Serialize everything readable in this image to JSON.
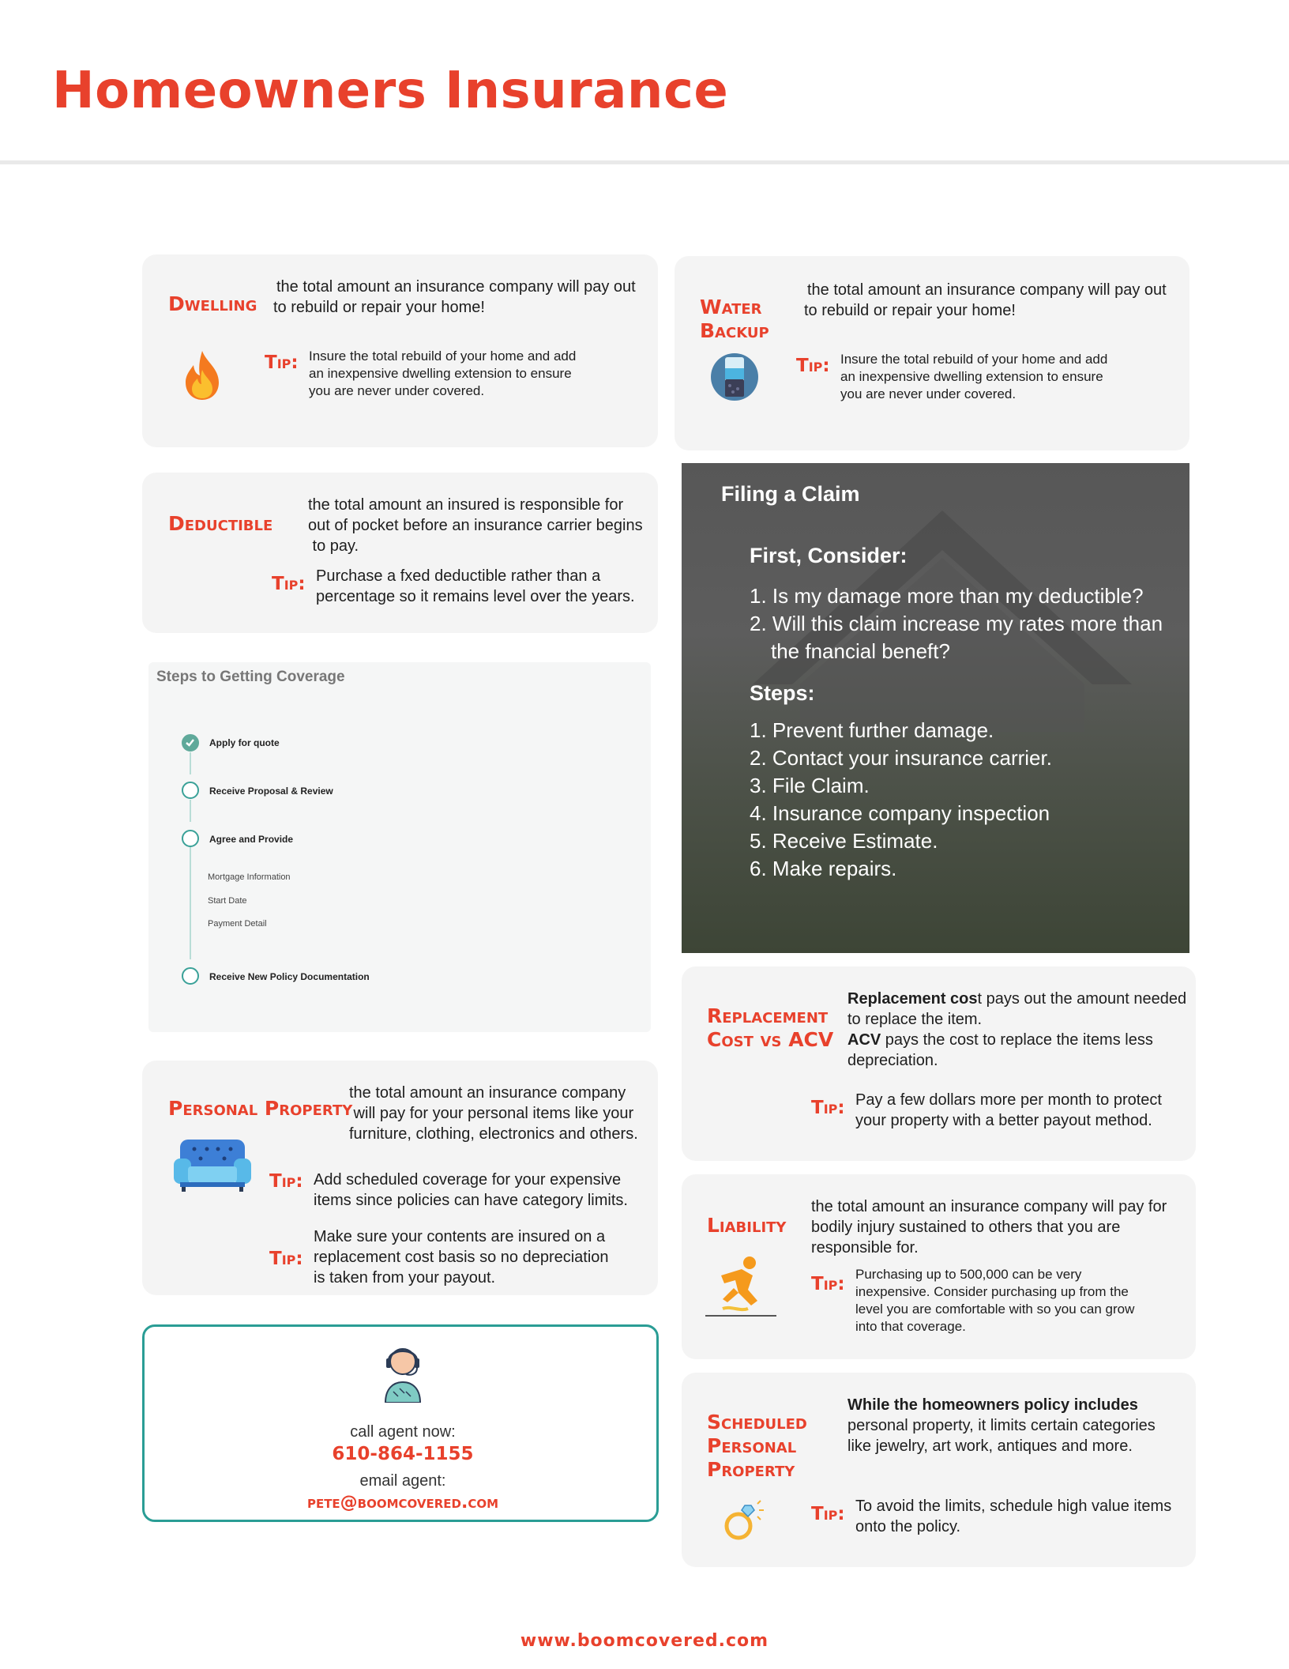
{
  "page": {
    "title": "Homeowners Insurance",
    "footer_url": "www.boomcovered.com"
  },
  "dwelling": {
    "label": "Dwelling",
    "desc": [
      "the total amount an insurance company will pay out",
      "to rebuild or repair your home!"
    ],
    "tip_label": "Tip:",
    "tip": [
      "Insure the total rebuild of your home and add",
      "an inexpensive dwelling extension to ensure",
      "you are never under covered."
    ],
    "icon": "fire-icon"
  },
  "water_backup": {
    "label": [
      "Water",
      "Backup"
    ],
    "desc": [
      "the total amount an insurance company will pay out",
      "to rebuild or repair your home!"
    ],
    "tip_label": "Tip:",
    "tip": [
      "Insure the total rebuild of your home and add",
      "an inexpensive dwelling extension to ensure",
      "you are never under covered."
    ],
    "icon": "water-level-icon"
  },
  "deductible": {
    "label": "Deductible",
    "desc": [
      "the total amount an insured is responsible for",
      "out of pocket before an insurance carrier begins",
      " to pay."
    ],
    "tip_label": "Tip:",
    "tip": [
      "Purchase a fxed deductible rather than a",
      "percentage so it remains level over the years."
    ]
  },
  "steps": {
    "title": "Steps to Getting Coverage",
    "items": [
      "Apply for quote",
      "Receive Proposal & Review",
      "Agree and Provide",
      "Receive New Policy Documentation"
    ],
    "sub_items": [
      "Mortgage Information",
      "Start Date",
      "Payment Detail"
    ]
  },
  "claim": {
    "title": "Filing a Claim",
    "consider_heading": "First, Consider:",
    "consider": [
      "1. Is my damage more than my deductible?",
      "2. Will this claim increase my rates more than",
      "the fnancial beneft?"
    ],
    "steps_heading": "Steps:",
    "steps": [
      "1. Prevent further damage.",
      "2. Contact your insurance carrier.",
      "3. File Claim.",
      "4. Insurance company inspection",
      "5. Receive Estimate.",
      "6. Make repairs."
    ]
  },
  "replacement": {
    "label": [
      "Replacement",
      "Cost vs ACV"
    ],
    "desc_bold_1": "Replacement cos",
    "desc_1": [
      "t pays out the amount needed",
      "to replace the item."
    ],
    "desc_bold_2": "ACV",
    "desc_2": [
      " pays the cost to replace the items less",
      "depreciation."
    ],
    "tip_label": "Tip:",
    "tip": [
      "Pay a few dollars more per month to protect",
      "your property with a better payout method."
    ]
  },
  "personal_property": {
    "label": "Personal Property",
    "desc": [
      "the total amount an insurance company",
      " will pay for your personal items like your",
      "furniture, clothing, electronics and others."
    ],
    "tip_label": "Tip:",
    "tip1": [
      "Add scheduled coverage for your expensive",
      "items since policies can have category limits."
    ],
    "tip2": [
      "Make sure your contents are insured on a",
      "replacement cost basis so no depreciation",
      "is taken from your payout."
    ],
    "icon": "sofa-icon"
  },
  "liability": {
    "label": "Liability",
    "desc": [
      "the total amount an insurance company will pay for",
      "bodily injury sustained to others that you are",
      "responsible for."
    ],
    "tip_label": "Tip:",
    "tip": [
      "Purchasing up to 500,000 can be very",
      "inexpensive. Consider purchasing up from the",
      "level you are comfortable with so you can grow",
      "into that coverage."
    ],
    "icon": "slip-fall-icon"
  },
  "scheduled": {
    "label": [
      "Scheduled",
      "Personal",
      "Property"
    ],
    "desc_bold": "While the homeowners policy includes",
    "desc": [
      "personal property, it limits certain categories",
      "like jewelry, art work, antiques and more."
    ],
    "tip_label": "Tip:",
    "tip": [
      "To avoid the limits, schedule high value items",
      "onto the policy."
    ],
    "icon": "diamond-ring-icon"
  },
  "contact": {
    "call_label": "call agent now:",
    "phone": "610-864-1155",
    "email_label": "email agent:",
    "email": "pete@boomcovered.com",
    "icon": "agent-headset-icon"
  }
}
